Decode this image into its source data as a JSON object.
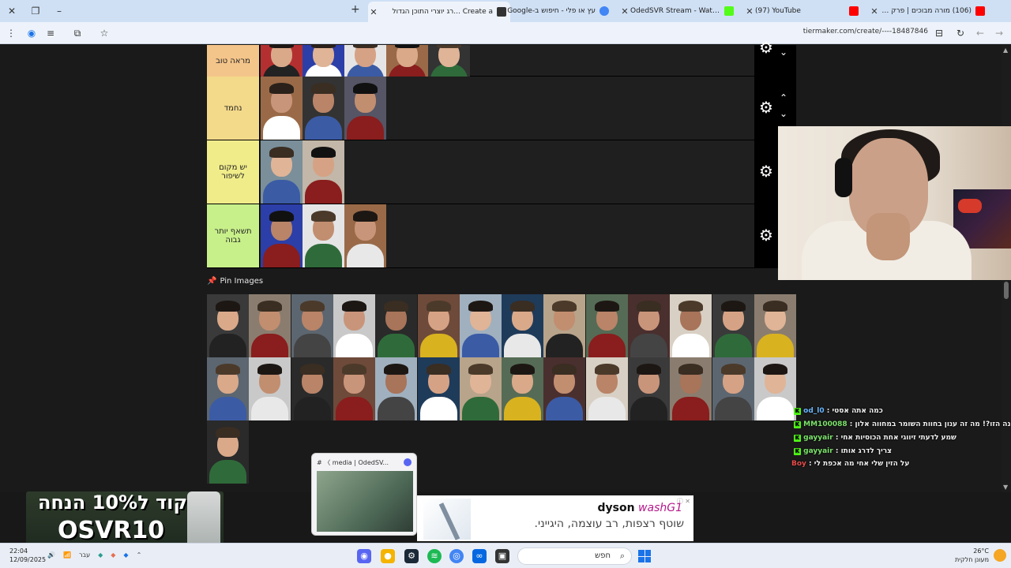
{
  "browser": {
    "tabs": [
      {
        "title": "Create a ...רג יוצרי התוכן הגדול",
        "active": true,
        "favicon_color": "#333333"
      },
      {
        "title": "עץ או פלי - חיפוש ב-Google",
        "active": false,
        "favicon_color": "#4285f4"
      },
      {
        "title": "OdedSVR Stream - Watch Live",
        "active": false,
        "favicon_color": "#53fc18"
      },
      {
        "title": "(97) YouTube",
        "active": false,
        "favicon_color": "#ff0000"
      },
      {
        "title": "(106) מורה מבוכים | פרק 1: ההג",
        "active": false,
        "favicon_color": "#ff0000"
      }
    ],
    "new_tab_label": "+",
    "url": "tiermaker.com/create/----18487846"
  },
  "tiers": [
    {
      "label": "מראה טוב",
      "color": "#f4c58a",
      "count": 5
    },
    {
      "label": "נחמד",
      "color": "#f3d98a",
      "count": 3
    },
    {
      "label": "יש מקום לשיפור",
      "color": "#f0ec8a",
      "count": 2
    },
    {
      "label": "תשאף יותר גבוה",
      "color": "#c8f08a",
      "count": 3
    }
  ],
  "pin_images": {
    "title": "Pin Images",
    "count": 29
  },
  "chat": [
    {
      "user": "od_l0",
      "message": "כמה אתה אסטי"
    },
    {
      "user": "MM100088",
      "message": "זה התמונה הזו?! מה זה ענון בחוות השומר במחווה אלון"
    },
    {
      "user": "gayyair",
      "message": "שמע לדעתי זיווגי אחת הכוסיות אחי"
    },
    {
      "user": "gayyair",
      "message": "צריך לדרג אותו"
    },
    {
      "user": "Boy",
      "message": "על הזין שלי אחי מה אכפת לי"
    }
  ],
  "promo": {
    "headline": "קוד ל10% הנחה",
    "code": "OSVR10"
  },
  "discord_popup": {
    "title": "# 〈 media | OdedSV..."
  },
  "ad": {
    "brand": "dyson",
    "model": "washG1",
    "text": "שוטף רצפות, רב עוצמה, היגייני."
  },
  "taskbar": {
    "time": "22:04",
    "date": "12/09/2025",
    "search_placeholder": "חפש",
    "tray_lang": "עבר",
    "weather_temp": "26°C",
    "weather_desc": "מעונן חלקית"
  }
}
